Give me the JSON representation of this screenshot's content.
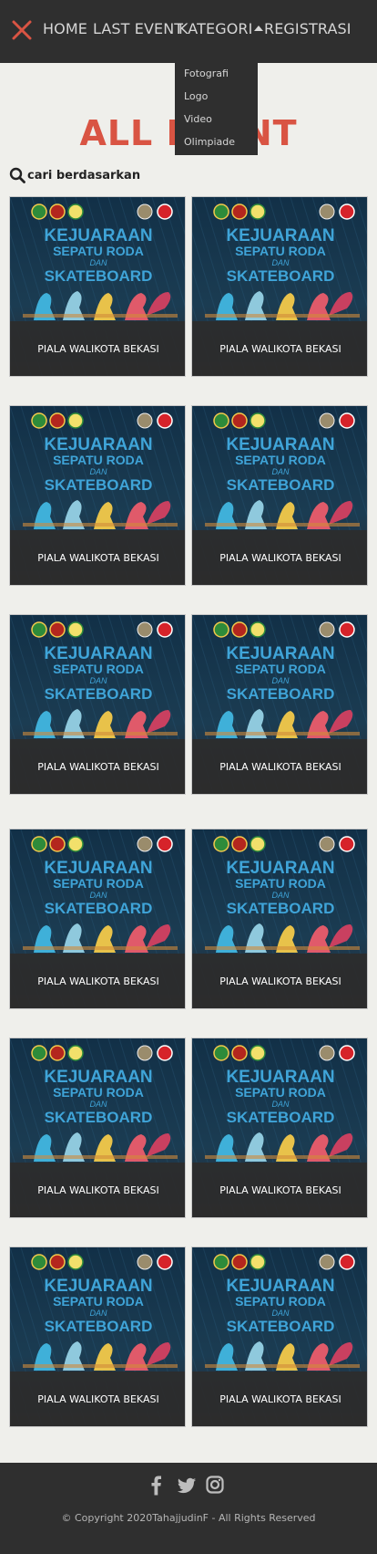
{
  "nav": {
    "items": [
      {
        "label": "HOME"
      },
      {
        "label": "LAST EVENT"
      },
      {
        "label": "KATEGORI"
      },
      {
        "label": "REGISTRASI"
      }
    ]
  },
  "dropdown": {
    "items": [
      {
        "label": "Fotografi"
      },
      {
        "label": "Logo"
      },
      {
        "label": "Video"
      },
      {
        "label": "Olimpiade"
      }
    ]
  },
  "page": {
    "title": "ALL EVENT"
  },
  "search": {
    "label": "cari berdasarkan"
  },
  "poster": {
    "line1": "KEJUARAAN",
    "line2": "SEPATU RODA",
    "line3": "DAN",
    "line4": "SKATEBOARD"
  },
  "events": [
    {
      "title": "PIALA WALIKOTA BEKASI"
    },
    {
      "title": "PIALA WALIKOTA BEKASI"
    },
    {
      "title": "PIALA WALIKOTA BEKASI"
    },
    {
      "title": "PIALA WALIKOTA BEKASI"
    },
    {
      "title": "PIALA WALIKOTA BEKASI"
    },
    {
      "title": "PIALA WALIKOTA BEKASI"
    },
    {
      "title": "PIALA WALIKOTA BEKASI"
    },
    {
      "title": "PIALA WALIKOTA BEKASI"
    },
    {
      "title": "PIALA WALIKOTA BEKASI"
    },
    {
      "title": "PIALA WALIKOTA BEKASI"
    },
    {
      "title": "PIALA WALIKOTA BEKASI"
    },
    {
      "title": "PIALA WALIKOTA BEKASI"
    }
  ],
  "footer": {
    "icons": [
      "facebook-icon",
      "twitter-icon",
      "instagram-icon"
    ],
    "copyright": "© Copyright 2020TahajjudinF - All Rights Reserved"
  },
  "colors": {
    "navbar": "#2f2f2f",
    "accent": "#d95443",
    "background": "#efefeb"
  }
}
